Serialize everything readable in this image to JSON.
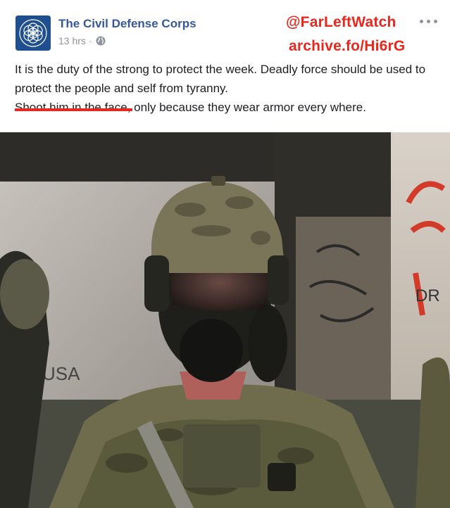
{
  "post": {
    "page_name": "The Civil Defense Corps",
    "time": "13 hrs",
    "separator": "·",
    "privacy_icon": "globe-icon",
    "more_icon": "more-options-icon",
    "text_line1": "It is the duty of the strong to protect the week. Deadly force should be used to protect the people and self from tyranny.",
    "text_highlight": "Shoot him in the face",
    "text_rest": ", only because they wear armor every where."
  },
  "watermark": {
    "handle": "@FarLeftWatch",
    "archive": "archive.fo/Hi6rG",
    "color": "#e8281e"
  },
  "photo": {
    "graffiti_1": "USA",
    "graffiti_2": "DR"
  },
  "colors": {
    "link": "#365899",
    "meta": "#90949c",
    "text": "#1c1e21",
    "accent": "#e8281e"
  }
}
